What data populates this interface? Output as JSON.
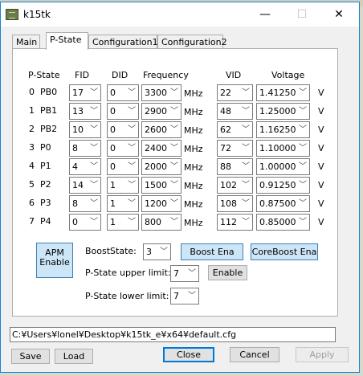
{
  "window": {
    "title": "k15tk",
    "minimize": "—",
    "maximize": "☐",
    "close": "✕"
  },
  "tabs": [
    "Main",
    "P-State",
    "Configuration1",
    "Configuration2"
  ],
  "headers": {
    "pstate": "P-State",
    "fid": "FID",
    "did": "DID",
    "frequency": "Frequency",
    "vid": "VID",
    "voltage": "Voltage"
  },
  "units": {
    "mhz": "MHz",
    "v": "V"
  },
  "rows": [
    {
      "num": "0",
      "name": "PB0",
      "fid": "17",
      "did": "0",
      "freq": "3300",
      "vid": "22",
      "volt": "1.41250"
    },
    {
      "num": "1",
      "name": "PB1",
      "fid": "13",
      "did": "0",
      "freq": "2900",
      "vid": "48",
      "volt": "1.25000"
    },
    {
      "num": "2",
      "name": "PB2",
      "fid": "10",
      "did": "0",
      "freq": "2600",
      "vid": "62",
      "volt": "1.16250"
    },
    {
      "num": "3",
      "name": "P0",
      "fid": "8",
      "did": "0",
      "freq": "2400",
      "vid": "72",
      "volt": "1.10000"
    },
    {
      "num": "4",
      "name": "P1",
      "fid": "4",
      "did": "0",
      "freq": "2000",
      "vid": "88",
      "volt": "1.00000"
    },
    {
      "num": "5",
      "name": "P2",
      "fid": "14",
      "did": "1",
      "freq": "1500",
      "vid": "102",
      "volt": "0.91250"
    },
    {
      "num": "6",
      "name": "P3",
      "fid": "8",
      "did": "1",
      "freq": "1200",
      "vid": "108",
      "volt": "0.87500"
    },
    {
      "num": "7",
      "name": "P4",
      "fid": "0",
      "did": "1",
      "freq": "800",
      "vid": "112",
      "volt": "0.85000"
    }
  ],
  "controls": {
    "apm_line1": "APM",
    "apm_line2": "Enable",
    "boost_state_label": "BoostState:",
    "boost_state_value": "3",
    "boost_ena": "Boost Ena",
    "coreboost_ena": "CoreBoost Ena",
    "upper_limit_label": "P-State upper limit:",
    "upper_limit_value": "7",
    "enable": "Enable",
    "lower_limit_label": "P-State lower limit:",
    "lower_limit_value": "7"
  },
  "path": "C:¥Users¥lonel¥Desktop¥k15tk_e¥x64¥default.cfg",
  "footer": {
    "save": "Save",
    "load": "Load",
    "close": "Close",
    "cancel": "Cancel",
    "apply": "Apply"
  },
  "dropdown_arrow": "﹀"
}
